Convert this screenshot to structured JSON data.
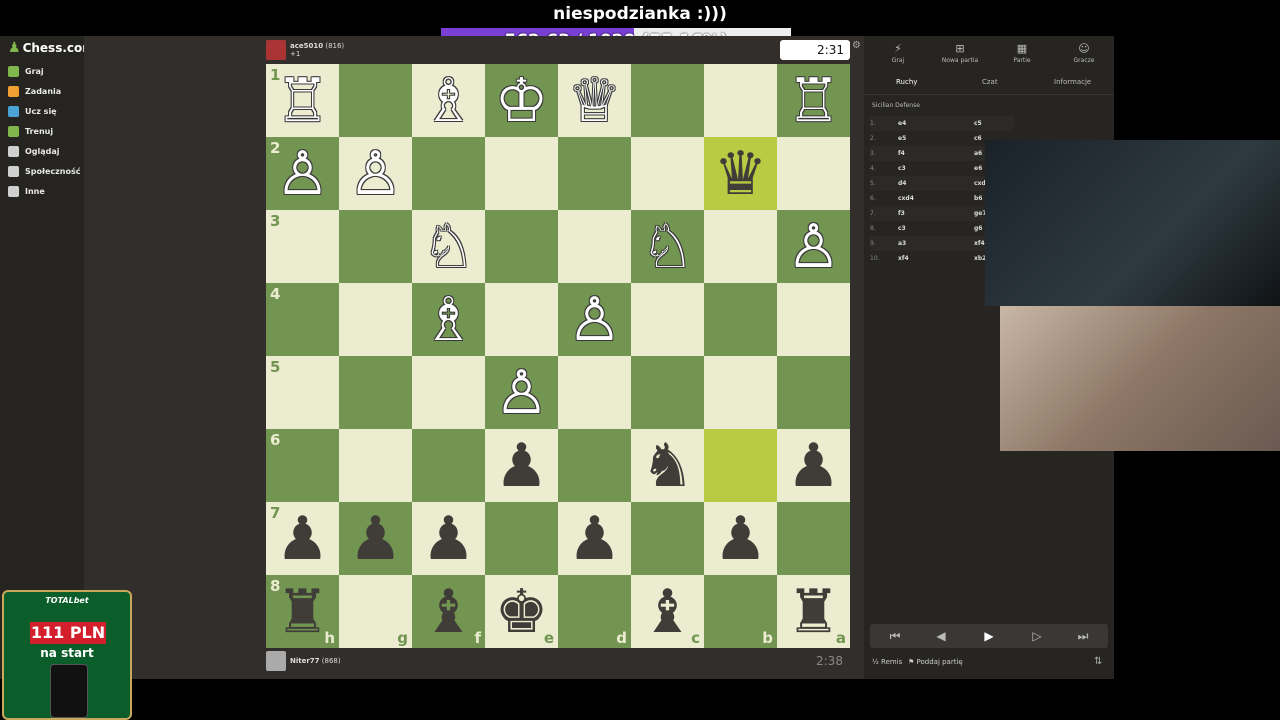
{
  "overlay": {
    "title": "niespodzianka :)))",
    "progress_text": "562.63 / 1020 (55.16%)",
    "progress_fraction": 0.5516,
    "accent": "#7a3fd3"
  },
  "site": {
    "logo": "Chess.com"
  },
  "nav": [
    {
      "label": "Graj",
      "icon": "play-icon"
    },
    {
      "label": "Zadania",
      "icon": "puzzle-icon"
    },
    {
      "label": "Ucz się",
      "icon": "learn-icon"
    },
    {
      "label": "Trenuj",
      "icon": "train-icon"
    },
    {
      "label": "Oglądaj",
      "icon": "watch-icon"
    },
    {
      "label": "Społeczność",
      "icon": "community-icon"
    },
    {
      "label": "Inne",
      "icon": "more-icon"
    }
  ],
  "top_player": {
    "name": "ace5010",
    "rating": "(816)",
    "extra": "+1",
    "clock": "2:31"
  },
  "bottom_player": {
    "name": "Niter77",
    "rating": "(868)",
    "clock": "2:38"
  },
  "board": {
    "ranks": [
      "1",
      "2",
      "3",
      "4",
      "5",
      "6",
      "7",
      "8"
    ],
    "files": [
      "h",
      "g",
      "f",
      "e",
      "d",
      "c",
      "b",
      "a"
    ],
    "pieces": [
      [
        "♖",
        "",
        "♗",
        "♔",
        "♕",
        "",
        "",
        "♖"
      ],
      [
        "♙",
        "♙",
        "",
        "",
        "",
        "",
        "♛",
        ""
      ],
      [
        "",
        "",
        "♘",
        "",
        "",
        "♘",
        "",
        "♙"
      ],
      [
        "",
        "",
        "♗",
        "",
        "♙",
        "",
        "",
        ""
      ],
      [
        "",
        "",
        "",
        "♙",
        "",
        "",
        "",
        ""
      ],
      [
        "",
        "",
        "",
        "♟",
        "",
        "♞",
        "",
        "♟"
      ],
      [
        "♟",
        "♟",
        "♟",
        "",
        "♟",
        "",
        "♟",
        ""
      ],
      [
        "♜",
        "",
        "♝",
        "♚",
        "",
        "♝",
        "",
        "♜"
      ]
    ],
    "colors": [
      [
        "w",
        "",
        "w",
        "w",
        "w",
        "",
        "",
        "w"
      ],
      [
        "w",
        "w",
        "",
        "",
        "",
        "",
        "b",
        ""
      ],
      [
        "",
        "",
        "w",
        "",
        "",
        "w",
        "",
        "w"
      ],
      [
        "",
        "",
        "w",
        "",
        "w",
        "",
        "",
        ""
      ],
      [
        "",
        "",
        "",
        "w",
        "",
        "",
        "",
        ""
      ],
      [
        "",
        "",
        "",
        "b",
        "",
        "b",
        "",
        "b"
      ],
      [
        "b",
        "b",
        "b",
        "",
        "b",
        "",
        "b",
        ""
      ],
      [
        "b",
        "",
        "b",
        "b",
        "",
        "b",
        "",
        "b"
      ]
    ]
  },
  "panel": {
    "tabs": [
      "Graj",
      "Nowa partia",
      "Partie",
      "Gracze"
    ],
    "subtabs": [
      "Ruchy",
      "Czat",
      "Informacje"
    ],
    "opening": "Sicilian Defense",
    "moves": [
      [
        "1.",
        "e4",
        "c5"
      ],
      [
        "2.",
        "e5",
        "c6"
      ],
      [
        "3.",
        "f4",
        "a6"
      ],
      [
        "4.",
        "c3",
        "e6"
      ],
      [
        "5.",
        "d4",
        "cxd4"
      ],
      [
        "6.",
        "cxd4",
        "b6"
      ],
      [
        "7.",
        "f3",
        "ge7"
      ],
      [
        "8.",
        "c3",
        "g6"
      ],
      [
        "9.",
        "a3",
        "xf4"
      ],
      [
        "10.",
        "xf4",
        "xb2"
      ]
    ],
    "draw": "Remis",
    "resign": "Poddaj partię"
  },
  "ad": {
    "brand": "TOTALbet",
    "amount": "111 PLN",
    "sub": "na start"
  }
}
